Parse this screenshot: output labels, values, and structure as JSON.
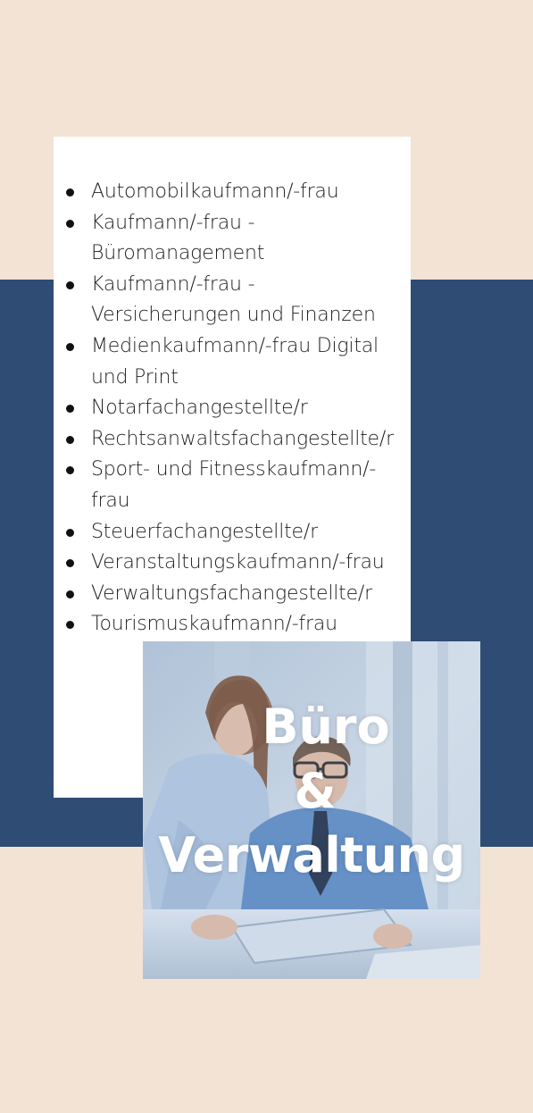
{
  "colors": {
    "background": "#f2e3d5",
    "band": "#2e4c74",
    "card": "#ffffff",
    "text": "#1f1f1f",
    "photo_title": "#ffffff"
  },
  "jobs": [
    "Automobilkaufmann/-frau",
    "Kaufmann/-frau - Büromanagement",
    "Kaufmann/-frau - Versicherungen und Finanzen",
    "Medienkaufmann/-frau Digital und Print",
    "Notarfachangestellte/r",
    "Rechtsanwaltsfachangestellte/r",
    "Sport- und Fitnesskaufmann/-frau",
    "Steuerfachangestellte/r",
    "Veranstaltungskaufmann/-frau",
    "Verwaltungsfachangestellte/r",
    "Tourismuskaufmann/-frau"
  ],
  "photo": {
    "title_line1": "Büro",
    "title_line2": "&",
    "title_line3": "Verwaltung"
  }
}
